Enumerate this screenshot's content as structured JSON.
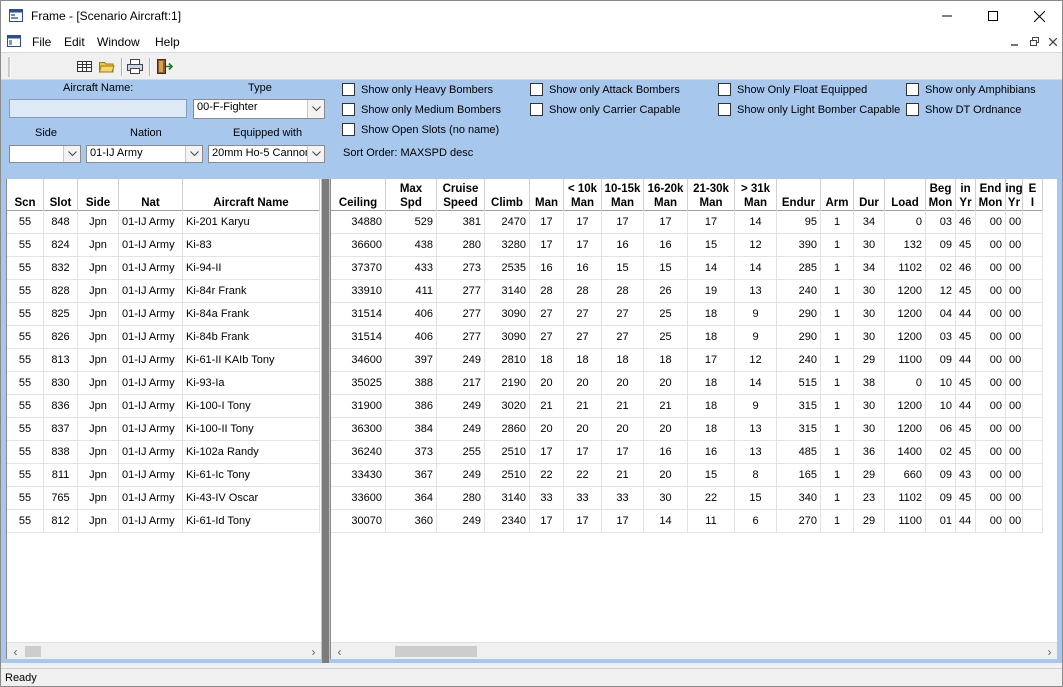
{
  "window": {
    "title": "Frame - [Scenario Aircraft:1]"
  },
  "menu": {
    "file": "File",
    "edit": "Edit",
    "window": "Window",
    "help": "Help"
  },
  "filters": {
    "aircraft_name_label": "Aircraft Name:",
    "aircraft_name_value": "",
    "type_label": "Type",
    "type_value": "00-F-Fighter",
    "side_label": "Side",
    "side_value": "",
    "nation_label": "Nation",
    "nation_value": "01-IJ Army",
    "equipped_label": "Equipped with",
    "equipped_value": "20mm Ho-5 Cannon",
    "checkboxes": [
      "Show only Heavy Bombers",
      "Show only Attack Bombers",
      "Show Only Float Equipped",
      "Show only Amphibians",
      "Show only Medium Bombers",
      "Show only Carrier Capable",
      "Show only Light Bomber Capable",
      "Show DT Ordnance",
      "Show Open Slots (no name)"
    ],
    "sort_order": "Sort Order: MAXSPD  desc"
  },
  "left_columns": [
    "Scn",
    "Slot",
    "Side",
    "Nat",
    "Aircraft Name"
  ],
  "right_columns": [
    "Ceiling",
    "Max\nSpd",
    "Cruise\nSpeed",
    "Climb",
    "Man",
    "< 10k\nMan",
    "10-15k\nMan",
    "16-20k\nMan",
    "21-30k\nMan",
    "> 31k\nMan",
    "Endur",
    "Arm",
    "Dur",
    "Load",
    "Beg\nMon",
    "in\nYr",
    "End\nMon",
    "ing\nYr",
    "E\nI"
  ],
  "rows": [
    {
      "scn": "55",
      "slot": "848",
      "side": "Jpn",
      "nat": "01-IJ Army",
      "name": "Ki-201 Karyu",
      "v": [
        "34880",
        "529",
        "381",
        "2470",
        "17",
        "17",
        "17",
        "17",
        "17",
        "14",
        "95",
        "1",
        "34",
        "0",
        "03",
        "46",
        "00",
        "00"
      ]
    },
    {
      "scn": "55",
      "slot": "824",
      "side": "Jpn",
      "nat": "01-IJ Army",
      "name": "Ki-83",
      "v": [
        "36600",
        "438",
        "280",
        "3280",
        "17",
        "17",
        "16",
        "16",
        "15",
        "12",
        "390",
        "1",
        "30",
        "132",
        "09",
        "45",
        "00",
        "00"
      ]
    },
    {
      "scn": "55",
      "slot": "832",
      "side": "Jpn",
      "nat": "01-IJ Army",
      "name": "Ki-94-II",
      "v": [
        "37370",
        "433",
        "273",
        "2535",
        "16",
        "16",
        "15",
        "15",
        "14",
        "14",
        "285",
        "1",
        "34",
        "1102",
        "02",
        "46",
        "00",
        "00"
      ]
    },
    {
      "scn": "55",
      "slot": "828",
      "side": "Jpn",
      "nat": "01-IJ Army",
      "name": "Ki-84r Frank",
      "v": [
        "33910",
        "411",
        "277",
        "3140",
        "28",
        "28",
        "28",
        "26",
        "19",
        "13",
        "240",
        "1",
        "30",
        "1200",
        "12",
        "45",
        "00",
        "00"
      ]
    },
    {
      "scn": "55",
      "slot": "825",
      "side": "Jpn",
      "nat": "01-IJ Army",
      "name": "Ki-84a Frank",
      "v": [
        "31514",
        "406",
        "277",
        "3090",
        "27",
        "27",
        "27",
        "25",
        "18",
        "9",
        "290",
        "1",
        "30",
        "1200",
        "04",
        "44",
        "00",
        "00"
      ]
    },
    {
      "scn": "55",
      "slot": "826",
      "side": "Jpn",
      "nat": "01-IJ Army",
      "name": "Ki-84b Frank",
      "v": [
        "31514",
        "406",
        "277",
        "3090",
        "27",
        "27",
        "27",
        "25",
        "18",
        "9",
        "290",
        "1",
        "30",
        "1200",
        "03",
        "45",
        "00",
        "00"
      ]
    },
    {
      "scn": "55",
      "slot": "813",
      "side": "Jpn",
      "nat": "01-IJ Army",
      "name": "Ki-61-II KAIb Tony",
      "v": [
        "34600",
        "397",
        "249",
        "2810",
        "18",
        "18",
        "18",
        "18",
        "17",
        "12",
        "240",
        "1",
        "29",
        "1100",
        "09",
        "44",
        "00",
        "00"
      ]
    },
    {
      "scn": "55",
      "slot": "830",
      "side": "Jpn",
      "nat": "01-IJ Army",
      "name": "Ki-93-Ia",
      "v": [
        "35025",
        "388",
        "217",
        "2190",
        "20",
        "20",
        "20",
        "20",
        "18",
        "14",
        "515",
        "1",
        "38",
        "0",
        "10",
        "45",
        "00",
        "00"
      ]
    },
    {
      "scn": "55",
      "slot": "836",
      "side": "Jpn",
      "nat": "01-IJ Army",
      "name": "Ki-100-I Tony",
      "v": [
        "31900",
        "386",
        "249",
        "3020",
        "21",
        "21",
        "21",
        "21",
        "18",
        "9",
        "315",
        "1",
        "30",
        "1200",
        "10",
        "44",
        "00",
        "00"
      ]
    },
    {
      "scn": "55",
      "slot": "837",
      "side": "Jpn",
      "nat": "01-IJ Army",
      "name": "Ki-100-II Tony",
      "v": [
        "36300",
        "384",
        "249",
        "2860",
        "20",
        "20",
        "20",
        "20",
        "18",
        "13",
        "315",
        "1",
        "30",
        "1200",
        "06",
        "45",
        "00",
        "00"
      ]
    },
    {
      "scn": "55",
      "slot": "838",
      "side": "Jpn",
      "nat": "01-IJ Army",
      "name": "Ki-102a Randy",
      "v": [
        "36240",
        "373",
        "255",
        "2510",
        "17",
        "17",
        "17",
        "16",
        "16",
        "13",
        "485",
        "1",
        "36",
        "1400",
        "02",
        "45",
        "00",
        "00"
      ]
    },
    {
      "scn": "55",
      "slot": "811",
      "side": "Jpn",
      "nat": "01-IJ Army",
      "name": "Ki-61-Ic Tony",
      "v": [
        "33430",
        "367",
        "249",
        "2510",
        "22",
        "22",
        "21",
        "20",
        "15",
        "8",
        "165",
        "1",
        "29",
        "660",
        "09",
        "43",
        "00",
        "00"
      ]
    },
    {
      "scn": "55",
      "slot": "765",
      "side": "Jpn",
      "nat": "01-IJ Army",
      "name": "Ki-43-IV Oscar",
      "v": [
        "33600",
        "364",
        "280",
        "3140",
        "33",
        "33",
        "33",
        "30",
        "22",
        "15",
        "340",
        "1",
        "23",
        "1102",
        "09",
        "45",
        "00",
        "00"
      ]
    },
    {
      "scn": "55",
      "slot": "812",
      "side": "Jpn",
      "nat": "01-IJ Army",
      "name": "Ki-61-Id Tony",
      "v": [
        "30070",
        "360",
        "249",
        "2340",
        "17",
        "17",
        "17",
        "14",
        "11",
        "6",
        "270",
        "1",
        "29",
        "1100",
        "01",
        "44",
        "00",
        "00"
      ]
    }
  ],
  "status": "Ready"
}
